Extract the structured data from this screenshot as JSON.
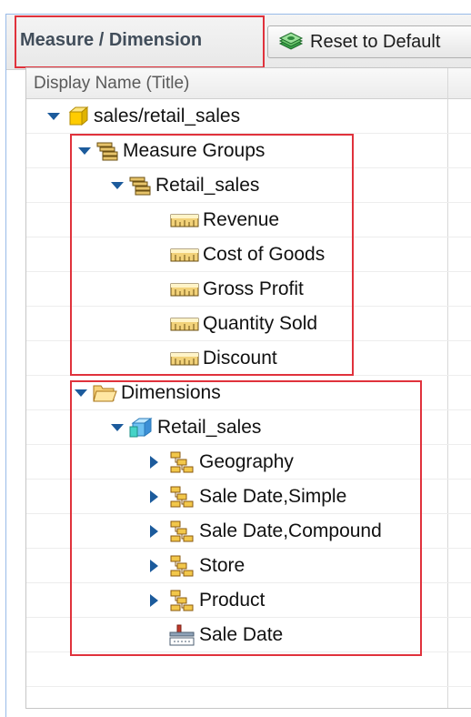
{
  "toolbar": {
    "title": "Measure / Dimension",
    "reset_label": "Reset to Default"
  },
  "grid": {
    "column_header": "Display Name (Title)"
  },
  "tree": {
    "root": "sales/retail_sales",
    "measure_groups": {
      "label": "Measure Groups",
      "group": "Retail_sales",
      "measures": [
        "Revenue",
        "Cost of Goods",
        "Gross Profit",
        "Quantity Sold",
        "Discount"
      ]
    },
    "dimensions": {
      "label": "Dimensions",
      "cube": "Retail_sales",
      "items": [
        "Geography",
        "Sale Date,Simple",
        "Sale Date,Compound",
        "Store",
        "Product"
      ],
      "sale_date": "Sale Date"
    }
  },
  "colors": {
    "highlight": "#e0323c",
    "toggle": "#1c5b9c",
    "panel_border": "#99bbe8"
  }
}
